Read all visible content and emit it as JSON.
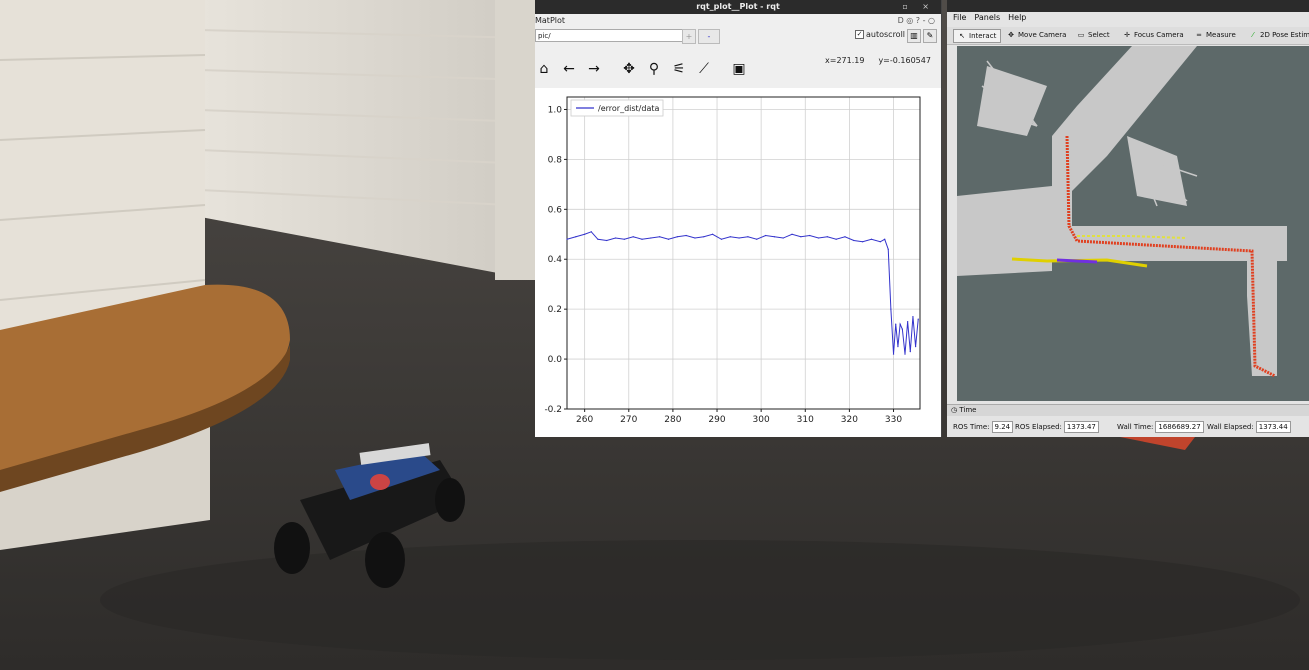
{
  "rqt": {
    "title": "rqt_plot__Plot - rqt",
    "window_buttons": "▫ ×",
    "matplot_label": "MatPlot",
    "controls_text": "D ◎ ? - ○",
    "topic_value": "pic/",
    "add_label": "+",
    "remove_label": "-",
    "autoscroll_label": "autoscroll",
    "autoscroll_checked": "✓",
    "toolbar": {
      "home_icon": "⌂",
      "back_icon": "←",
      "forward_icon": "→",
      "pan_icon": "✥",
      "zoom_icon": "⚲",
      "configure_icon": "⚟",
      "edit_curves_icon": "⟋",
      "save_icon": "▣"
    },
    "x_readout": "x=271.19",
    "y_readout": "y=-0.160547"
  },
  "chart_data": {
    "type": "line",
    "title": "",
    "xlabel": "",
    "ylabel": "",
    "xlim": [
      256,
      336
    ],
    "ylim": [
      -0.2,
      1.05
    ],
    "x_ticks": [
      260,
      270,
      280,
      290,
      300,
      310,
      320,
      330
    ],
    "y_ticks": [
      -0.2,
      0.0,
      0.2,
      0.4,
      0.6,
      0.8,
      1.0
    ],
    "grid": true,
    "legend_position": "top-left",
    "series": [
      {
        "name": "/error_dist/data",
        "color": "#3333cc",
        "x": [
          256,
          258,
          260,
          261.5,
          263,
          265,
          267,
          269,
          271,
          273,
          275,
          277,
          279,
          281,
          283,
          285,
          287,
          289,
          291,
          293,
          295,
          297,
          299,
          301,
          303,
          305,
          307,
          309,
          311,
          313,
          315,
          317,
          319,
          321,
          323,
          325,
          327,
          328,
          328.8,
          329.4,
          330,
          330.5,
          331,
          331.5,
          332,
          332.6,
          333.2,
          333.8,
          334.4,
          335,
          335.6
        ],
        "y": [
          0.48,
          0.49,
          0.5,
          0.51,
          0.48,
          0.475,
          0.485,
          0.48,
          0.49,
          0.48,
          0.485,
          0.49,
          0.48,
          0.49,
          0.495,
          0.485,
          0.49,
          0.5,
          0.48,
          0.49,
          0.485,
          0.49,
          0.48,
          0.495,
          0.49,
          0.485,
          0.5,
          0.49,
          0.495,
          0.485,
          0.49,
          0.48,
          0.49,
          0.475,
          0.47,
          0.48,
          0.47,
          0.48,
          0.44,
          0.2,
          0.02,
          0.14,
          0.05,
          0.14,
          0.12,
          0.02,
          0.15,
          0.03,
          0.17,
          0.05,
          0.16
        ]
      }
    ]
  },
  "rviz": {
    "menu": {
      "file": "File",
      "panels": "Panels",
      "help": "Help"
    },
    "tools": {
      "interact": "Interact",
      "move_camera": "Move Camera",
      "select": "Select",
      "focus_camera": "Focus Camera",
      "measure": "Measure",
      "pose_estimate": "2D Pose Estim"
    },
    "time_panel_title": "Time",
    "ros_time_label": "ROS Time:",
    "ros_time_value": "9.24",
    "ros_elapsed_label": "ROS Elapsed:",
    "ros_elapsed_value": "1373.47",
    "wall_time_label": "Wall Time:",
    "wall_time_value": "1686689.27",
    "wall_elapsed_label": "Wall Elapsed:",
    "wall_elapsed_value": "1373.44"
  }
}
